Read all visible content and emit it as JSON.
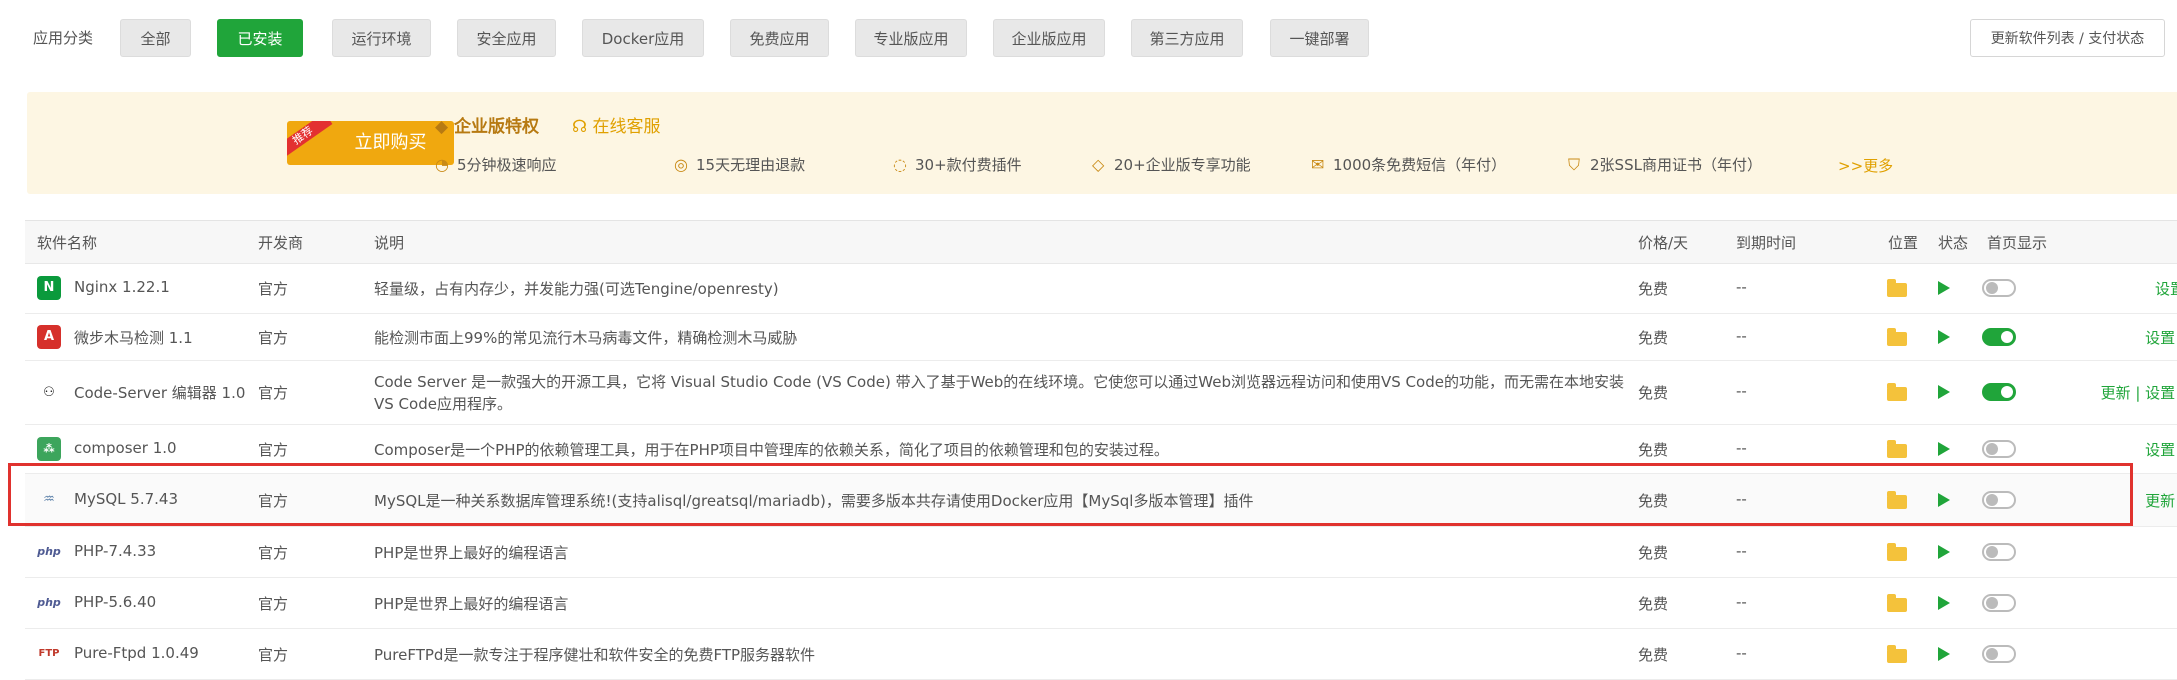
{
  "categories": {
    "label": "应用分类",
    "items": [
      "全部",
      "已安装",
      "运行环境",
      "安全应用",
      "Docker应用",
      "免费应用",
      "专业版应用",
      "企业版应用",
      "第三方应用",
      "一键部署"
    ],
    "active": "已安装"
  },
  "update_button": "更新软件列表 / 支付状态",
  "banner": {
    "recommend_tag": "推荐",
    "buy_label": "立即购买",
    "enterprise_privilege": "企业版特权",
    "online_support": "在线客服",
    "perks": [
      "5分钟极速响应",
      "15天无理由退款",
      "30+款付费插件",
      "20+企业版专享功能",
      "1000条免费短信（年付）",
      "2张SSL商用证书（年付）"
    ],
    "more": ">>更多"
  },
  "table": {
    "headers": [
      "软件名称",
      "开发商",
      "说明",
      "价格/天",
      "到期时间",
      "位置",
      "状态",
      "首页显示"
    ],
    "rows": [
      {
        "name": "Nginx 1.22.1",
        "vendor": "官方",
        "desc": "轻量级，占有内存少，并发能力强(可选Tengine/openresty)",
        "price": "免费",
        "expire": "--",
        "home": false,
        "ops": "设置"
      },
      {
        "name": "微步木马检测 1.1",
        "vendor": "官方",
        "desc": "能检测市面上99%的常见流行木马病毒文件，精确检测木马威胁",
        "price": "免费",
        "expire": "--",
        "home": true,
        "ops": "设置 | "
      },
      {
        "name": "Code-Server 编辑器 1.0",
        "vendor": "官方",
        "desc": "Code Server 是一款强大的开源工具，它将 Visual Studio Code (VS Code) 带入了基于Web的在线环境。它使您可以通过Web浏览器远程访问和使用VS Code的功能，而无需在本地安装",
        "desc2": "VS Code应用程序。",
        "price": "免费",
        "expire": "--",
        "home": true,
        "ops": "更新 | 设置 | "
      },
      {
        "name": "composer 1.0",
        "vendor": "官方",
        "desc": "Composer是一个PHP的依赖管理工具，用于在PHP项目中管理库的依赖关系，简化了项目的依赖管理和包的安装过程。",
        "price": "免费",
        "expire": "--",
        "home": false,
        "ops": "设置 | "
      },
      {
        "name": "MySQL 5.7.43",
        "vendor": "官方",
        "desc": "MySQL是一种关系数据库管理系统!(支持alisql/greatsql/mariadb)，需要多版本共存请使用Docker应用【MySql多版本管理】插件",
        "price": "免费",
        "expire": "--",
        "home": false,
        "ops": "更新 | "
      },
      {
        "name": "PHP-7.4.33",
        "vendor": "官方",
        "desc": "PHP是世界上最好的编程语言",
        "price": "免费",
        "expire": "--",
        "home": false,
        "ops": ""
      },
      {
        "name": "PHP-5.6.40",
        "vendor": "官方",
        "desc": "PHP是世界上最好的编程语言",
        "price": "免费",
        "expire": "--",
        "home": false,
        "ops": ""
      },
      {
        "name": "Pure-Ftpd 1.0.49",
        "vendor": "官方",
        "desc": "PureFTPd是一款专注于程序健壮和软件安全的免费FTP服务器软件",
        "price": "免费",
        "expire": "--",
        "home": false,
        "ops": ""
      }
    ]
  },
  "colors": {
    "accent": "#20a53a",
    "highlight": "#e0322e",
    "buy": "#f0a80f"
  }
}
